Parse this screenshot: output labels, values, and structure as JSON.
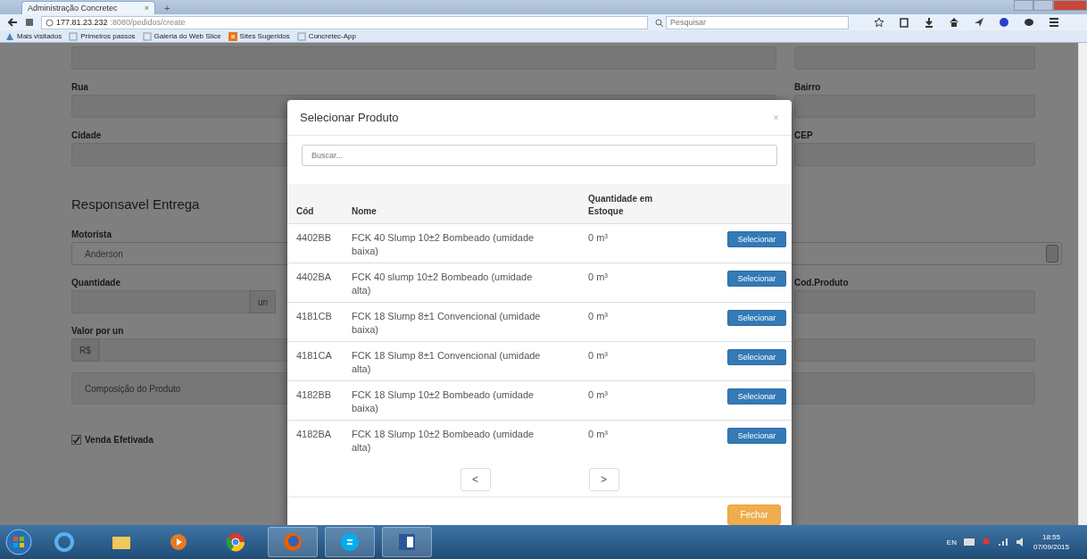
{
  "browser": {
    "tab": {
      "title": "Administração Concretec",
      "close": "×"
    },
    "new_tab": "+",
    "url": {
      "host": "177.81.23.232",
      "path": ":8080/pedidos/create"
    },
    "search": {
      "placeholder": "Pesquisar"
    },
    "bookmarks": [
      {
        "kind": "smart",
        "label": "Mais visitados"
      },
      {
        "kind": "folder",
        "label": "Primeiros passos"
      },
      {
        "kind": "folder",
        "label": "Galeria do Web Slice"
      },
      {
        "kind": "feed",
        "label": "Sites Sugeridos"
      },
      {
        "kind": "folder",
        "label": "Concretec-App"
      }
    ]
  },
  "form": {
    "rows": [
      [
        {
          "kind": "field",
          "label": "Rua"
        },
        {
          "kind": "field",
          "label": "Bairro"
        }
      ],
      [
        {
          "kind": "field",
          "label": "Cidade"
        },
        {
          "kind": "field",
          "label": "CEP"
        }
      ],
      [
        {
          "kind": "heading",
          "text": "Responsavel Entrega"
        }
      ],
      [
        {
          "kind": "select",
          "label": "Motorista",
          "value": "Anderson"
        }
      ],
      [
        {
          "kind": "field",
          "label": "Quantidade",
          "suffix": "un"
        },
        {
          "kind": "field",
          "label": "Cod.Produto"
        }
      ],
      [
        {
          "kind": "field",
          "label": "Valor por un",
          "prefix": "R$"
        },
        {
          "kind": "field"
        }
      ],
      [
        {
          "kind": "textarea",
          "placeholder": "Composição do Produto"
        }
      ],
      [
        {
          "kind": "checkbox",
          "label": "Venda Efetivada",
          "checked": true
        }
      ]
    ]
  },
  "modal": {
    "title": "Selecionar Produto",
    "close": "×",
    "search": {
      "placeholder": "Buscar..."
    },
    "table": {
      "columns": [
        "Cód",
        "Nome",
        "Quantidade em Estoque"
      ],
      "rows": [
        {
          "code": "4402BB",
          "name": "FCK 40 Slump 10±2 Bombeado (umidade baixa)",
          "stock": "0 m³",
          "action": "Selecionar"
        },
        {
          "code": "4402BA",
          "name": "FCK 40 slump 10±2 Bombeado (umidade alta)",
          "stock": "0 m³",
          "action": "Selecionar"
        },
        {
          "code": "4181CB",
          "name": "FCK 18 Slump 8±1 Convencional (umidade baixa)",
          "stock": "0 m³",
          "action": "Selecionar"
        },
        {
          "code": "4181CA",
          "name": "FCK 18 Slump 8±1 Convencional (umidade alta)",
          "stock": "0 m³",
          "action": "Selecionar"
        },
        {
          "code": "4182BB",
          "name": "FCK 18 Slump 10±2 Bombeado (umidade baixa)",
          "stock": "0 m³",
          "action": "Selecionar"
        },
        {
          "code": "4182BA",
          "name": "FCK 18 Slump 10±2 Bombeado (umidade alta)",
          "stock": "0 m³",
          "action": "Selecionar"
        }
      ]
    },
    "pagination": {
      "prev": "<",
      "next": ">"
    },
    "close_button": "Fechar"
  },
  "taskbar": {
    "language": "EN",
    "time": "18:55",
    "date": "07/09/2015"
  }
}
